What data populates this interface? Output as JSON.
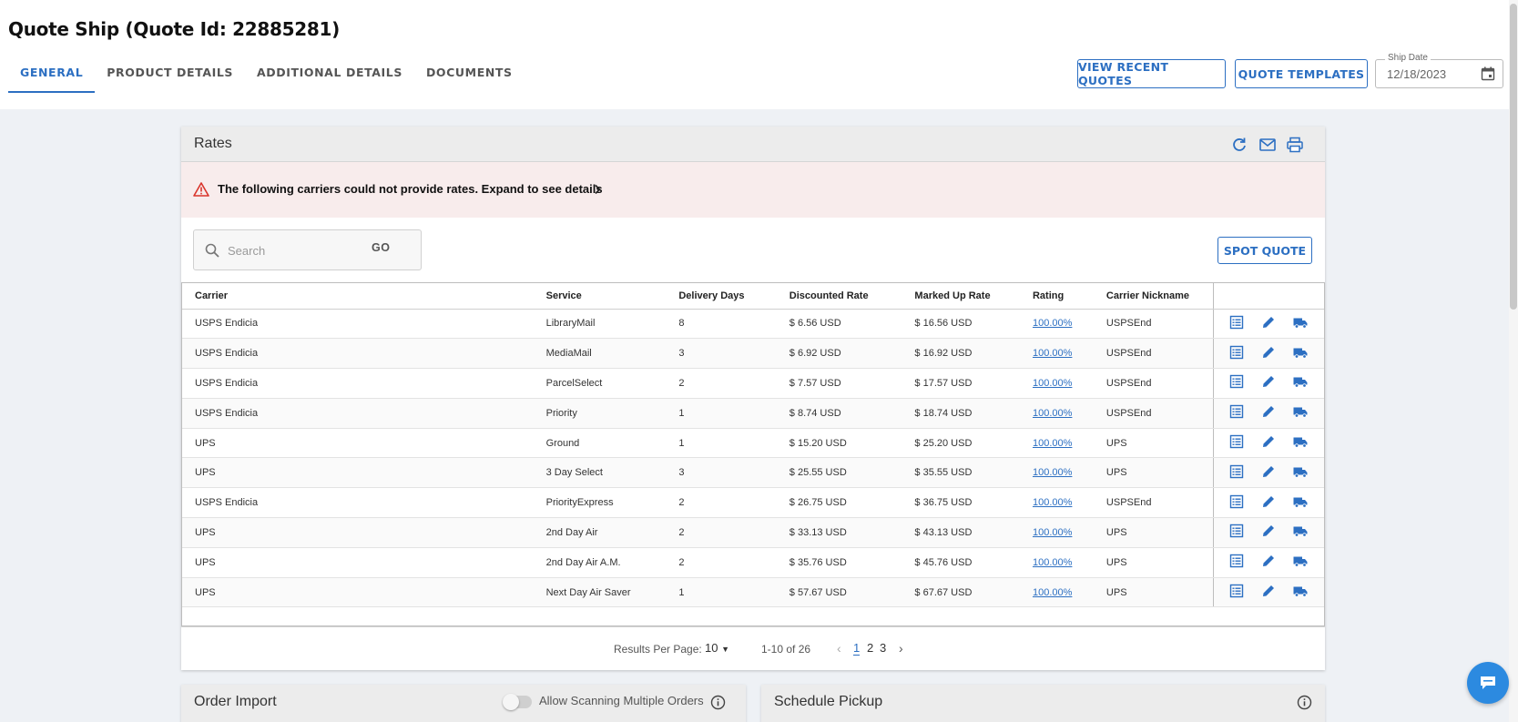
{
  "page": {
    "title": "Quote Ship (Quote Id: 22885281)",
    "tabs": [
      "GENERAL",
      "PRODUCT DETAILS",
      "ADDITIONAL DETAILS",
      "DOCUMENTS"
    ],
    "active_tab": "GENERAL"
  },
  "header_buttons": {
    "view_recent_quotes": "VIEW RECENT QUOTES",
    "quote_templates": "QUOTE TEMPLATES"
  },
  "ship_date": {
    "label": "Ship Date",
    "value": "12/18/2023"
  },
  "rates": {
    "title": "Rates",
    "alert_text": "The following carriers could not provide rates. Expand to see details",
    "search_placeholder": "Search",
    "go_label": "GO",
    "spot_quote_label": "SPOT QUOTE",
    "columns": [
      "Carrier",
      "Service",
      "Delivery Days",
      "Discounted Rate",
      "Marked Up Rate",
      "Rating",
      "Carrier Nickname"
    ],
    "rows": [
      {
        "carrier": "USPS Endicia",
        "service": "LibraryMail",
        "days": "8",
        "discounted": "$ 6.56 USD",
        "markedup": "$ 16.56 USD",
        "rating": "100.00%",
        "nickname": "USPSEnd"
      },
      {
        "carrier": "USPS Endicia",
        "service": "MediaMail",
        "days": "3",
        "discounted": "$ 6.92 USD",
        "markedup": "$ 16.92 USD",
        "rating": "100.00%",
        "nickname": "USPSEnd"
      },
      {
        "carrier": "USPS Endicia",
        "service": "ParcelSelect",
        "days": "2",
        "discounted": "$ 7.57 USD",
        "markedup": "$ 17.57 USD",
        "rating": "100.00%",
        "nickname": "USPSEnd"
      },
      {
        "carrier": "USPS Endicia",
        "service": "Priority",
        "days": "1",
        "discounted": "$ 8.74 USD",
        "markedup": "$ 18.74 USD",
        "rating": "100.00%",
        "nickname": "USPSEnd"
      },
      {
        "carrier": "UPS",
        "service": "Ground",
        "days": "1",
        "discounted": "$ 15.20 USD",
        "markedup": "$ 25.20 USD",
        "rating": "100.00%",
        "nickname": "UPS"
      },
      {
        "carrier": "UPS",
        "service": "3 Day Select",
        "days": "3",
        "discounted": "$ 25.55 USD",
        "markedup": "$ 35.55 USD",
        "rating": "100.00%",
        "nickname": "UPS"
      },
      {
        "carrier": "USPS Endicia",
        "service": "PriorityExpress",
        "days": "2",
        "discounted": "$ 26.75 USD",
        "markedup": "$ 36.75 USD",
        "rating": "100.00%",
        "nickname": "USPSEnd"
      },
      {
        "carrier": "UPS",
        "service": "2nd Day Air",
        "days": "2",
        "discounted": "$ 33.13 USD",
        "markedup": "$ 43.13 USD",
        "rating": "100.00%",
        "nickname": "UPS"
      },
      {
        "carrier": "UPS",
        "service": "2nd Day Air A.M.",
        "days": "2",
        "discounted": "$ 35.76 USD",
        "markedup": "$ 45.76 USD",
        "rating": "100.00%",
        "nickname": "UPS"
      },
      {
        "carrier": "UPS",
        "service": "Next Day Air Saver",
        "days": "1",
        "discounted": "$ 57.67 USD",
        "markedup": "$ 67.67 USD",
        "rating": "100.00%",
        "nickname": "UPS"
      }
    ],
    "pagination": {
      "results_label": "Results Per Page:",
      "per_page": "10",
      "range": "1-10 of 26",
      "pages": [
        "1",
        "2",
        "3"
      ],
      "current": "1"
    }
  },
  "order_import": {
    "title": "Order Import",
    "toggle_label": "Allow Scanning Multiple Orders"
  },
  "schedule_pickup": {
    "title": "Schedule Pickup"
  },
  "colors": {
    "accent": "#2c6fc2",
    "alert_bg": "#f8ecec",
    "alert_icon": "#d9342b",
    "chat": "#2c8ae0"
  },
  "icons": {
    "header": [
      "refresh-icon",
      "email-icon",
      "print-icon"
    ],
    "row_actions": [
      "details-icon",
      "edit-icon",
      "ship-truck-icon"
    ]
  }
}
